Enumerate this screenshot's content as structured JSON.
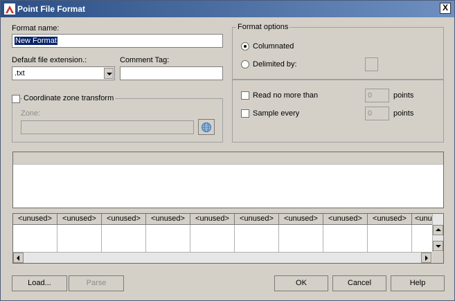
{
  "window": {
    "title": "Point File Format",
    "close_label": "X"
  },
  "format_name": {
    "label": "Format name:",
    "value": "New Format"
  },
  "default_ext": {
    "label": "Default file extension.:",
    "value": ".txt"
  },
  "comment_tag": {
    "label": "Comment Tag:",
    "value": ""
  },
  "coord_zone": {
    "label": "Coordinate zone transform",
    "zone_label": "Zone:",
    "zone_value": ""
  },
  "format_options": {
    "legend": "Format options",
    "columnated_label": "Columnated",
    "delimited_label": "Delimited by:",
    "delimiter_value": "",
    "selected": "Columnated"
  },
  "limits": {
    "read_label": "Read no more than",
    "read_value": "0",
    "read_unit": "points",
    "sample_label": "Sample every",
    "sample_value": "0",
    "sample_unit": "points"
  },
  "grid": {
    "columns": [
      "<unused>",
      "<unused>",
      "<unused>",
      "<unused>",
      "<unused>",
      "<unused>",
      "<unused>",
      "<unused>",
      "<unused>",
      "<unused>"
    ]
  },
  "buttons": {
    "load": "Load...",
    "parse": "Parse",
    "ok": "OK",
    "cancel": "Cancel",
    "help": "Help"
  },
  "colors": {
    "title_bar": "#2b4f86",
    "dialog_bg": "#d4d0c8",
    "selection": "#0a246a"
  }
}
